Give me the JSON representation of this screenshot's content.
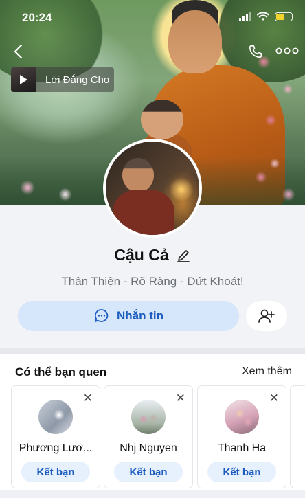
{
  "status_bar": {
    "time": "20:24"
  },
  "music": {
    "title": "Lời Đắng Cho"
  },
  "profile": {
    "name": "Cậu Cả",
    "bio": "Thân Thiện - Rõ Ràng - Dứt Khoát!",
    "message_button": "Nhắn tin"
  },
  "suggestions": {
    "title": "Có thể bạn quen",
    "see_more": "Xem thêm",
    "close_glyph": "✕",
    "add_friend_label": "Kết bạn",
    "cards": [
      {
        "name": "Phương Lươ..."
      },
      {
        "name": "Nhj Nguyen"
      },
      {
        "name": "Thanh Ha"
      }
    ]
  },
  "colors": {
    "accent": "#1a5bbf",
    "message_button_bg": "#d6e6fb",
    "add_friend_bg": "#e7f0fd"
  }
}
